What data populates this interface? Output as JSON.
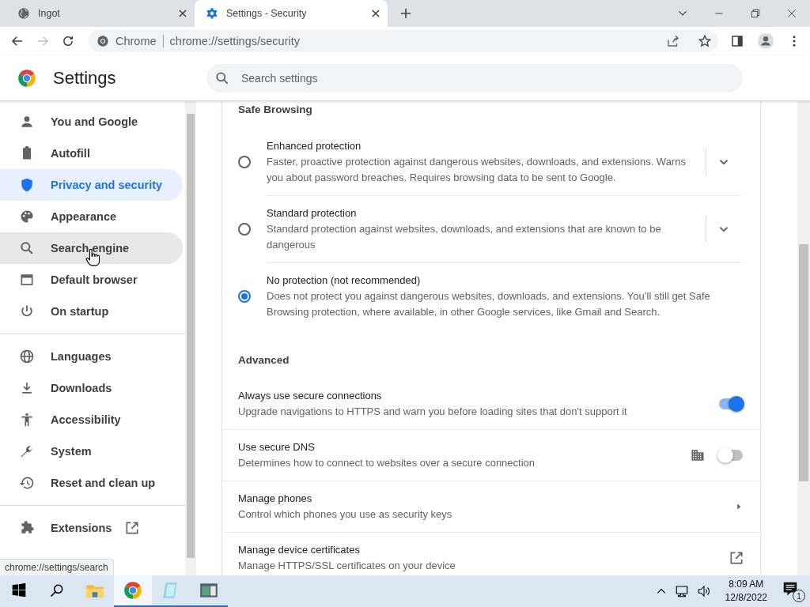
{
  "tabs": [
    {
      "title": "Ingot",
      "selected": false
    },
    {
      "title": "Settings - Security",
      "selected": true
    }
  ],
  "toolbar": {
    "site_label": "Chrome",
    "url": "chrome://settings/security"
  },
  "header": {
    "title": "Settings",
    "search": {
      "placeholder": "Search settings"
    }
  },
  "sidebar": {
    "sections": [
      {
        "items": [
          {
            "label": "You and Google",
            "kind": "page",
            "selected": false,
            "hovered": false
          },
          {
            "label": "Autofill",
            "kind": "page",
            "selected": false,
            "hovered": false
          },
          {
            "label": "Privacy and security",
            "kind": "page",
            "selected": true,
            "hovered": false
          },
          {
            "label": "Appearance",
            "kind": "page",
            "selected": false,
            "hovered": false
          },
          {
            "label": "Search engine",
            "kind": "page",
            "selected": false,
            "hovered": true
          },
          {
            "label": "Default browser",
            "kind": "page",
            "selected": false,
            "hovered": false
          },
          {
            "label": "On startup",
            "kind": "page",
            "selected": false,
            "hovered": false
          }
        ]
      },
      {
        "items": [
          {
            "label": "Languages",
            "kind": "page",
            "selected": false,
            "hovered": false
          },
          {
            "label": "Downloads",
            "kind": "page",
            "selected": false,
            "hovered": false
          },
          {
            "label": "Accessibility",
            "kind": "page",
            "selected": false,
            "hovered": false
          },
          {
            "label": "System",
            "kind": "page",
            "selected": false,
            "hovered": false
          },
          {
            "label": "Reset and clean up",
            "kind": "page",
            "selected": false,
            "hovered": false
          }
        ]
      },
      {
        "items": [
          {
            "label": "Extensions",
            "kind": "external",
            "selected": false,
            "hovered": false
          }
        ]
      }
    ]
  },
  "safe_browsing": {
    "heading": "Safe Browsing",
    "options": [
      {
        "title": "Enhanced protection",
        "description": "Faster, proactive protection against dangerous websites, downloads, and extensions. Warns you about password breaches. Requires browsing data to be sent to Google.",
        "selected": false,
        "expandable": true
      },
      {
        "title": "Standard protection",
        "description": "Standard protection against websites, downloads, and extensions that are known to be dangerous",
        "selected": false,
        "expandable": true
      },
      {
        "title": "No protection (not recommended)",
        "description": "Does not protect you against dangerous websites, downloads, and extensions. You’ll still get Safe Browsing protection, where available, in other Google services, like Gmail and Search.",
        "selected": true,
        "expandable": false
      }
    ]
  },
  "advanced": {
    "heading": "Advanced",
    "rows": [
      {
        "kind": "toggle",
        "title": "Always use secure connections",
        "description": "Upgrade navigations to HTTPS and warn you before loading sites that don't support it",
        "on": true,
        "managed": false
      },
      {
        "kind": "toggle",
        "title": "Use secure DNS",
        "description": "Determines how to connect to websites over a secure connection",
        "on": false,
        "managed": true
      },
      {
        "kind": "subpage",
        "title": "Manage phones",
        "description": "Control which phones you use as security keys"
      },
      {
        "kind": "external",
        "title": "Manage device certificates",
        "description": "Manage HTTPS/SSL certificates on your device"
      }
    ]
  },
  "status_tooltip": "chrome://settings/search",
  "taskbar": {
    "apps": [
      {
        "kind": "explorer",
        "running": false,
        "selected": false
      },
      {
        "kind": "chrome",
        "running": true,
        "selected": true
      },
      {
        "kind": "notepad",
        "running": true,
        "selected": false
      },
      {
        "kind": "window",
        "running": true,
        "selected": false
      }
    ],
    "time": "8:09 AM",
    "date": "12/8/2022",
    "notification_count": "1"
  }
}
